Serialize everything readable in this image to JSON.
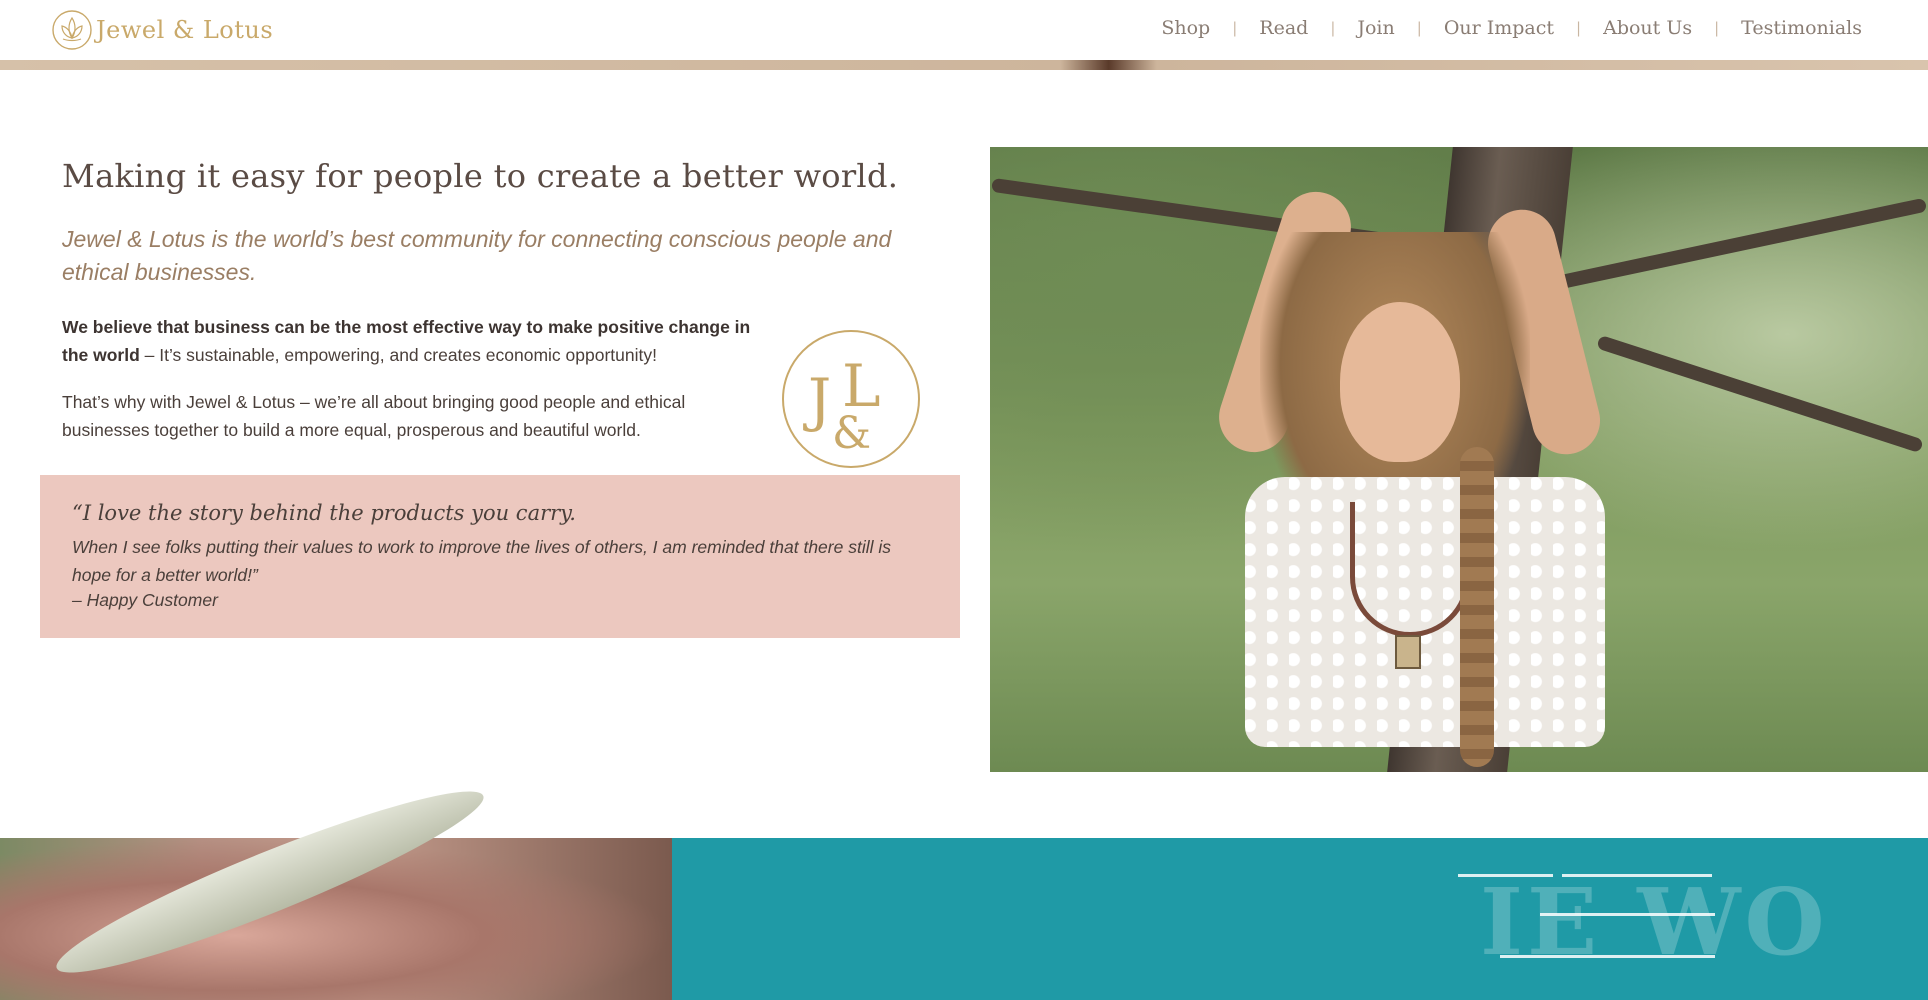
{
  "header": {
    "logo_text": "Jewel & Lotus",
    "nav": [
      "Shop",
      "Read",
      "Join",
      "Our Impact",
      "About Us",
      "Testimonials"
    ],
    "separator": "|"
  },
  "main": {
    "headline": "Making it easy for people to create a better world.",
    "intro": "Jewel & Lotus is the world’s best community for connecting conscious people and ethical businesses.",
    "para1_bold": "We believe that business can be the most effective way to make positive change in the world",
    "para1_rest": " – It’s sustainable, empowering, and creates economic opportunity!",
    "para2": "That’s why with Jewel & Lotus – we’re all about bringing good people and ethical businesses together to build a more equal, prosperous and beautiful world.",
    "monogram": {
      "letter1": "J",
      "letter2": "L",
      "letter3": "&"
    }
  },
  "quote": {
    "title": "“I love the story behind the products you carry.",
    "body": "When I see folks putting their values to work to improve the lives of others, I am reminded that there still is hope for a better world!”",
    "attribution": "– Happy Customer"
  },
  "bottom": {
    "partial_heading": "IE WO"
  },
  "colors": {
    "gold": "#c9a96a",
    "quote_bg": "#ecc8bf",
    "teal": "#1f9aa6",
    "intro_text": "#9a7e64"
  }
}
